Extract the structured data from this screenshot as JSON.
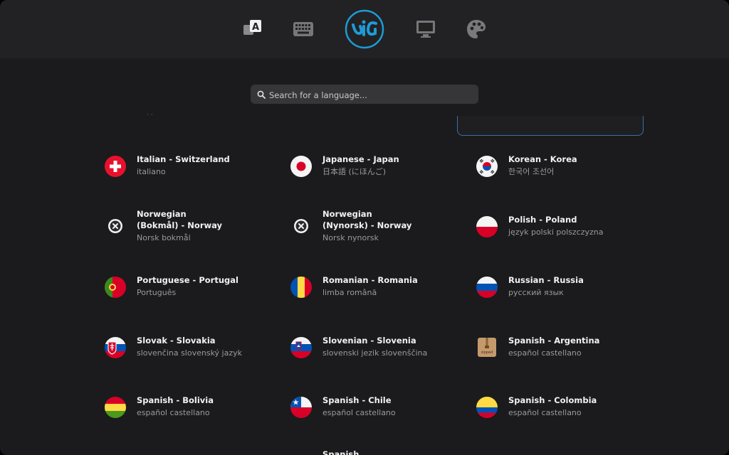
{
  "search": {
    "placeholder": "Search for a language..."
  },
  "languages": [
    {
      "title": "Italian - Switzerland",
      "sub": "italiano",
      "flag": "switzerland"
    },
    {
      "title": "Japanese - Japan",
      "sub": "日本語 (にほんご)",
      "flag": "japan"
    },
    {
      "title": "Korean - Korea",
      "sub": "한국어 조선어",
      "flag": "korea"
    },
    {
      "title_line1": "Norwegian",
      "title_line2": "(Bokmål) - Norway",
      "sub": "Norsk bokmål",
      "flag": "unknown"
    },
    {
      "title_line1": "Norwegian",
      "title_line2": "(Nynorsk) - Norway",
      "sub": "Norsk nynorsk",
      "flag": "unknown"
    },
    {
      "title": "Polish - Poland",
      "sub": "język polski polszczyzna",
      "flag": "poland"
    },
    {
      "title": "Portuguese - Portugal",
      "sub": "Português",
      "flag": "portugal"
    },
    {
      "title": "Romanian - Romania",
      "sub": "limba română",
      "flag": "romania"
    },
    {
      "title": "Russian - Russia",
      "sub": "русский язык",
      "flag": "russia"
    },
    {
      "title": "Slovak - Slovakia",
      "sub": "slovenčina slovenský jazyk",
      "flag": "slovakia"
    },
    {
      "title": "Slovenian - Slovenia",
      "sub": "slovenski jezik slovenščina",
      "flag": "slovenia"
    },
    {
      "title": "Spanish - Argentina",
      "sub": "español castellano",
      "flag": "zipped"
    },
    {
      "title": "Spanish - Bolivia",
      "sub": "español castellano",
      "flag": "bolivia"
    },
    {
      "title": "Spanish - Chile",
      "sub": "español castellano",
      "flag": "chile"
    },
    {
      "title": "Spanish - Colombia",
      "sub": "español castellano",
      "flag": "colombia"
    }
  ],
  "partial_next": "Spanish",
  "zipped_label": "zipped",
  "keyboard_icon_letter": "A",
  "colors": {
    "accent": "#3b6ea8",
    "logo": "#1e9bd7"
  }
}
